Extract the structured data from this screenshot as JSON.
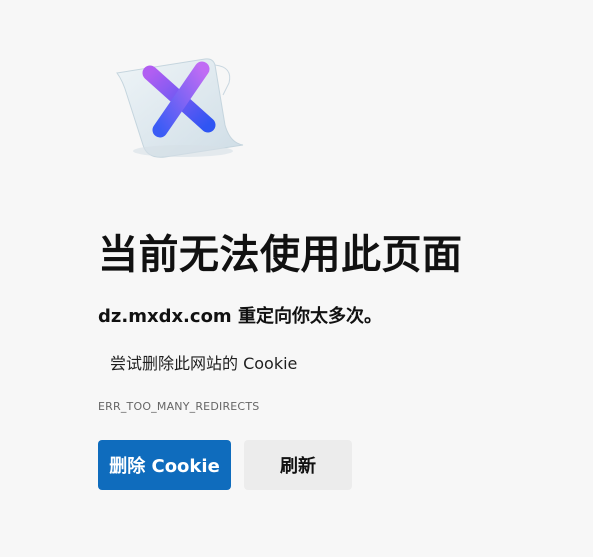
{
  "error_page": {
    "title": "当前无法使用此页面",
    "subtitle": "dz.mxdx.com 重定向你太多次。",
    "suggestions": [
      "尝试删除此网站的 Cookie"
    ],
    "error_code": "ERR_TOO_MANY_REDIRECTS"
  },
  "buttons": {
    "delete_cookie_label": "删除 Cookie",
    "refresh_label": "刷新"
  },
  "illustration": {
    "icon": "error-x-icon",
    "colors": {
      "x_start": "#a45cf0",
      "x_end": "#2f5cf5",
      "paper": "#dfe9ef"
    }
  }
}
